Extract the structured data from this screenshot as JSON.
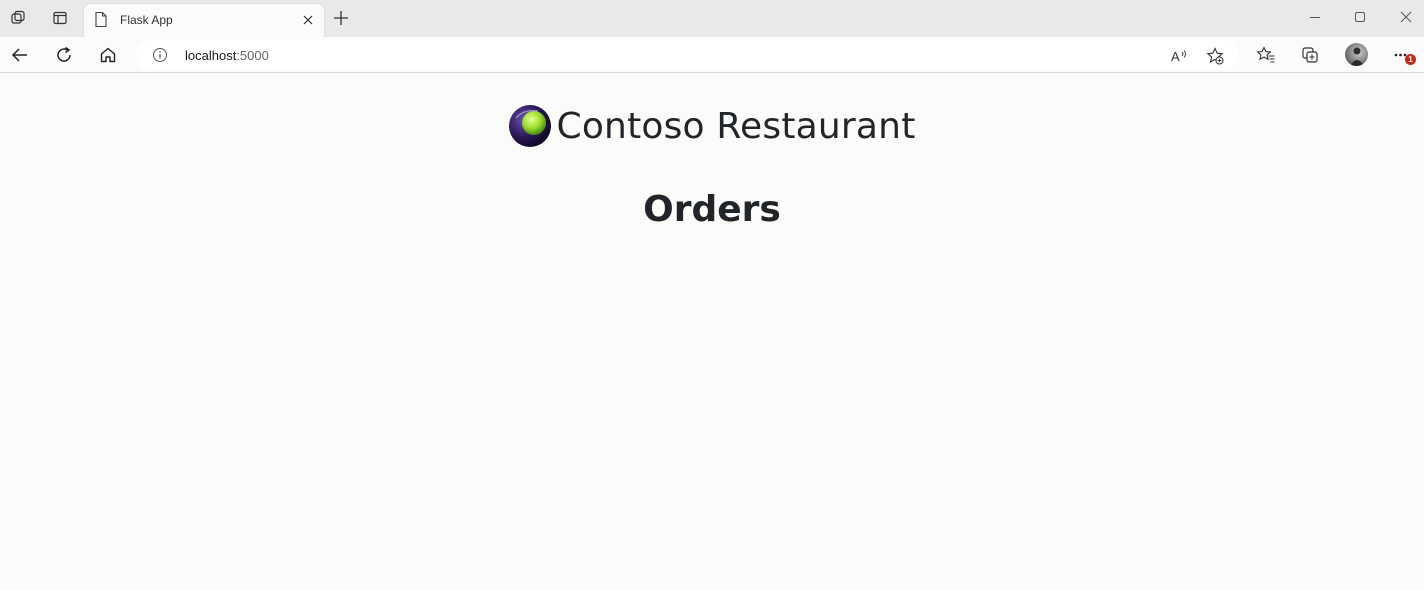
{
  "browser": {
    "tab": {
      "title": "Flask App"
    },
    "address_bar": {
      "host": "localhost",
      "port": ":5000"
    },
    "profile": {
      "notification_count": "1"
    }
  },
  "page": {
    "brand_name": "Contoso Restaurant",
    "heading": "Orders"
  },
  "icons": [
    "workspaces-icon",
    "vertical-tabs-icon",
    "page-icon",
    "close-icon",
    "plus-icon",
    "minimize-icon",
    "maximize-icon",
    "window-close-icon",
    "back-arrow-icon",
    "refresh-icon",
    "home-icon",
    "info-icon",
    "read-aloud-icon",
    "add-favorite-icon",
    "favorites-icon",
    "collections-icon",
    "more-icon",
    "contoso-logo"
  ],
  "colors": {
    "badge": "#c42b1c",
    "text": "#212529",
    "logo_green": "#9ee02c",
    "logo_purple": "#3b1f6e"
  }
}
